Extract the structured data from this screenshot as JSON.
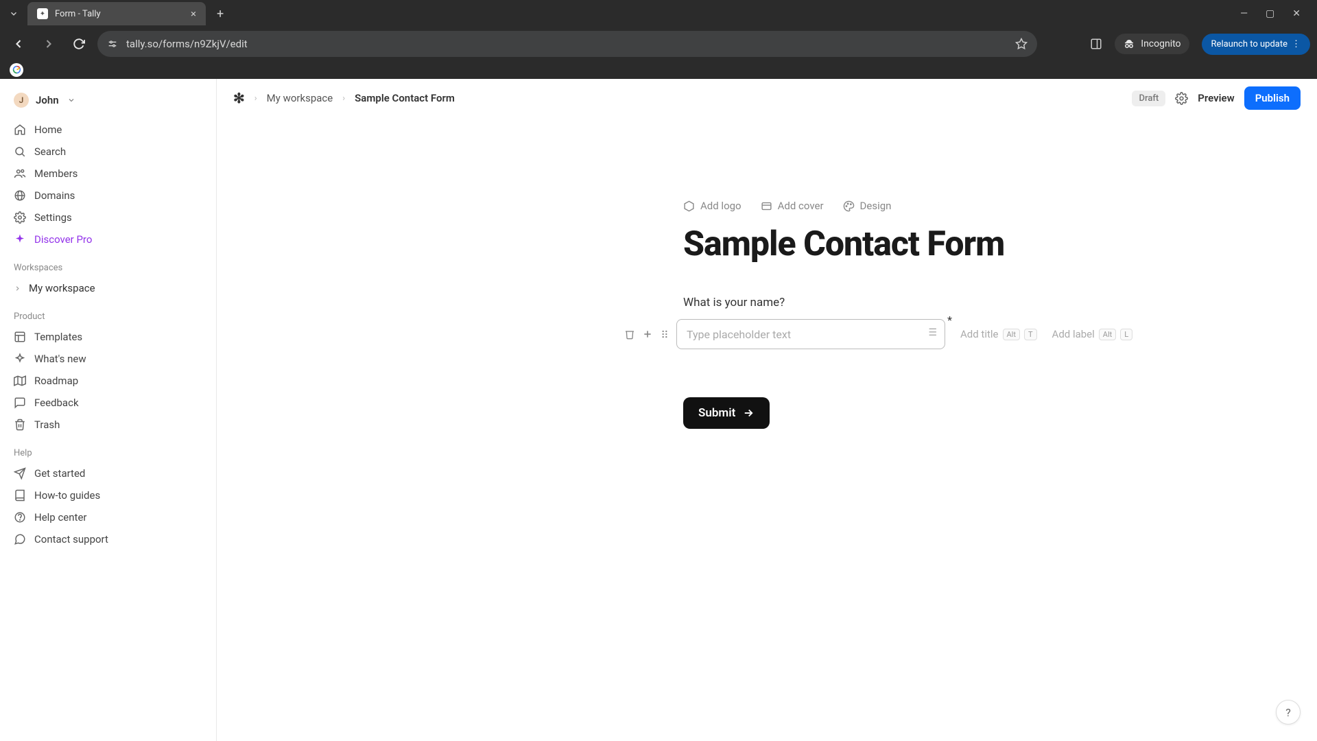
{
  "browser": {
    "tab_title": "Form - Tally",
    "url": "tally.so/forms/n9ZkjV/edit",
    "incognito_label": "Incognito",
    "relaunch_label": "Relaunch to update"
  },
  "user": {
    "initial": "J",
    "name": "John"
  },
  "sidebar": {
    "main": [
      {
        "icon": "home",
        "label": "Home"
      },
      {
        "icon": "search",
        "label": "Search"
      },
      {
        "icon": "members",
        "label": "Members"
      },
      {
        "icon": "domains",
        "label": "Domains"
      },
      {
        "icon": "settings",
        "label": "Settings"
      },
      {
        "icon": "sparkle",
        "label": "Discover Pro",
        "pro": true
      }
    ],
    "workspaces_label": "Workspaces",
    "workspaces": [
      {
        "label": "My workspace"
      }
    ],
    "product_label": "Product",
    "product": [
      {
        "icon": "templates",
        "label": "Templates"
      },
      {
        "icon": "whatsnew",
        "label": "What's new"
      },
      {
        "icon": "roadmap",
        "label": "Roadmap"
      },
      {
        "icon": "feedback",
        "label": "Feedback"
      },
      {
        "icon": "trash",
        "label": "Trash"
      }
    ],
    "help_label": "Help",
    "help": [
      {
        "icon": "getstarted",
        "label": "Get started"
      },
      {
        "icon": "howto",
        "label": "How-to guides"
      },
      {
        "icon": "helpcenter",
        "label": "Help center"
      },
      {
        "icon": "contact",
        "label": "Contact support"
      }
    ]
  },
  "topbar": {
    "breadcrumb_workspace": "My workspace",
    "breadcrumb_form": "Sample Contact Form",
    "draft_label": "Draft",
    "preview_label": "Preview",
    "publish_label": "Publish"
  },
  "form": {
    "meta": {
      "add_logo": "Add logo",
      "add_cover": "Add cover",
      "design": "Design"
    },
    "title": "Sample Contact Form",
    "question": "What is your name?",
    "placeholder": "Type placeholder text",
    "add_title_hint": "Add title",
    "add_label_hint": "Add label",
    "kbd_alt": "Alt",
    "kbd_t": "T",
    "kbd_l": "L",
    "submit_label": "Submit"
  },
  "help_fab": "?"
}
